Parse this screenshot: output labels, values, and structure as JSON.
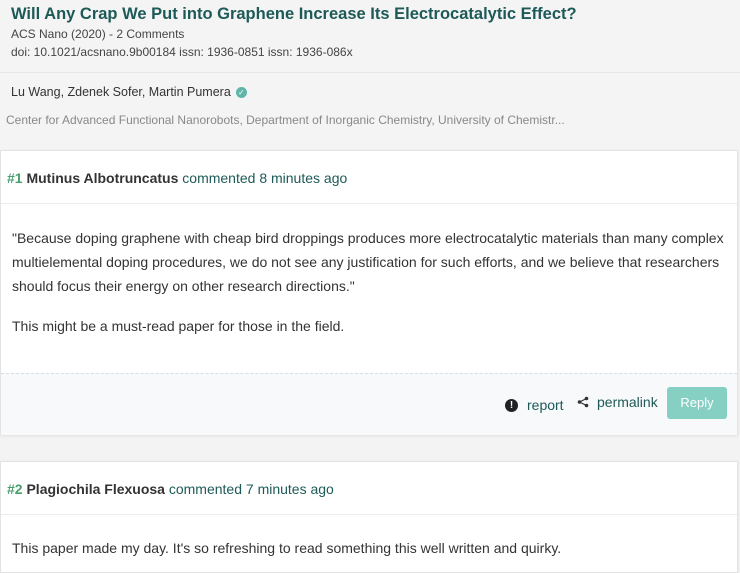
{
  "paper": {
    "title": "Will Any Crap We Put into Graphene Increase Its Electrocatalytic Effect?",
    "journal_line": "ACS Nano (2020) - 2 Comments",
    "ids_line": "doi: 10.1021/acsnano.9b00184  issn: 1936-0851  issn: 1936-086x",
    "authors": "Lu Wang, Zdenek Sofer, Martin Pumera",
    "affiliation": "Center for Advanced Functional Nanorobots, Department of Inorganic Chemistry, University of Chemistr..."
  },
  "comments": [
    {
      "number": "#1",
      "author": "Mutinus Albotruncatus",
      "time": "commented 8 minutes ago",
      "paragraphs": [
        "\"Because doping graphene with cheap bird droppings produces more electrocatalytic materials than many complex multielemental doping procedures, we do not see any justification for such efforts, and we believe that researchers should focus their energy on other research directions.\"",
        "This might be a must-read paper for those in the field."
      ],
      "actions": {
        "report": "report",
        "permalink": "permalink",
        "reply": "Reply"
      }
    },
    {
      "number": "#2",
      "author": "Plagiochila Flexuosa",
      "time": "commented 7 minutes ago",
      "paragraphs": [
        "This paper made my day. It's so refreshing to read something this well written and quirky."
      ]
    }
  ],
  "icons": {
    "verified": "verified-check-icon",
    "report": "exclamation-circle-icon",
    "permalink": "share-icon"
  },
  "colors": {
    "title": "#1d5a57",
    "number": "#4a9e6f",
    "reply_button": "#86cfc3"
  }
}
